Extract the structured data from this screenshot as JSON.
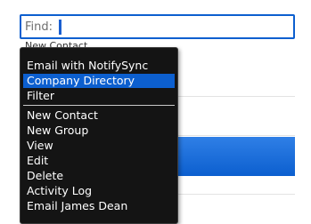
{
  "search": {
    "label": "Find:",
    "value": ""
  },
  "list": {
    "partial_row": "New Contact"
  },
  "menu": {
    "items": [
      {
        "label": "Email with NotifySync"
      },
      {
        "label": "Company Directory"
      },
      {
        "label": "Filter"
      },
      {
        "label": "New Contact"
      },
      {
        "label": "New Group"
      },
      {
        "label": "View"
      },
      {
        "label": "Edit"
      },
      {
        "label": "Delete"
      },
      {
        "label": "Activity Log"
      },
      {
        "label": "Email James Dean"
      }
    ],
    "highlighted_index": 1
  },
  "colors": {
    "accent": "#0c5fcf",
    "menu_bg": "#141414"
  }
}
